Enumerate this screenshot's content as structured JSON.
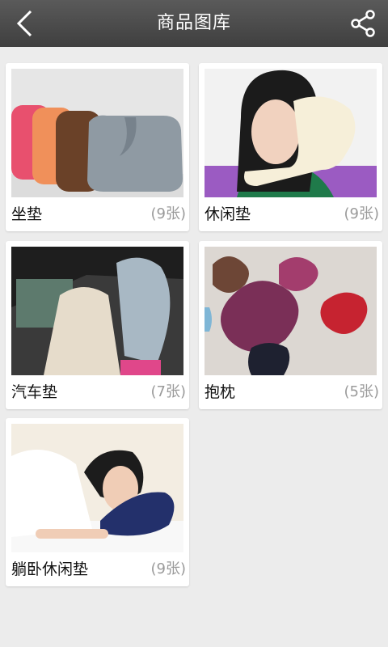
{
  "header": {
    "title": "商品图库",
    "back_icon": "chevron-left-icon",
    "share_icon": "share-icon"
  },
  "categories": [
    {
      "label": "坐垫",
      "count": "(9张)",
      "image": "seat-cushions-photo"
    },
    {
      "label": "休闲垫",
      "count": "(9张)",
      "image": "neck-pillow-woman-photo"
    },
    {
      "label": "汽车垫",
      "count": "(7张)",
      "image": "car-headrest-photo"
    },
    {
      "label": "抱枕",
      "count": "(5张)",
      "image": "cross-shaped-pillows-photo"
    },
    {
      "label": "躺卧休闲垫",
      "count": "(9张)",
      "image": "lying-woman-pillow-photo"
    }
  ]
}
